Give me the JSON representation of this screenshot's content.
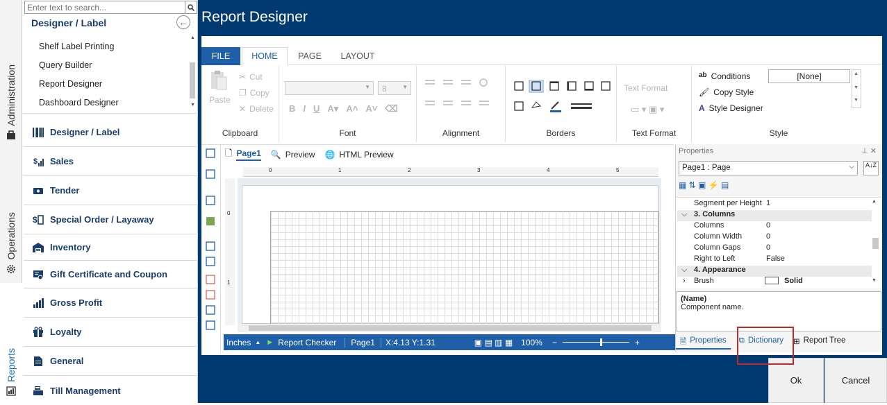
{
  "vertical_tabs": [
    {
      "label": "Administration",
      "icon": "briefcase-icon"
    },
    {
      "label": "Operations",
      "icon": "gear-icon"
    },
    {
      "label": "Reports",
      "icon": "report-icon"
    }
  ],
  "search": {
    "placeholder": "Enter text to search..."
  },
  "nav": {
    "title": "Designer / Label",
    "subitems": [
      "Shelf Label Printing",
      "Query Builder",
      "Report Designer",
      "Dashboard Designer"
    ],
    "categories": [
      {
        "label": "Designer / Label",
        "icon": "barcode-icon"
      },
      {
        "label": "Sales",
        "icon": "sales-icon"
      },
      {
        "label": "Tender",
        "icon": "tender-icon"
      },
      {
        "label": "Special Order / Layaway",
        "icon": "special-order-icon"
      },
      {
        "label": "Inventory",
        "icon": "warehouse-icon"
      },
      {
        "label": "Gift Certificate and Coupon",
        "icon": "certificate-icon"
      },
      {
        "label": "Gross Profit",
        "icon": "bar-chart-icon"
      },
      {
        "label": "Loyalty",
        "icon": "gift-icon"
      },
      {
        "label": "General",
        "icon": "document-icon"
      },
      {
        "label": "Till Management",
        "icon": "cash-register-icon"
      }
    ]
  },
  "window": {
    "title": "Report Designer"
  },
  "ribbon": {
    "tabs": [
      "FILE",
      "HOME",
      "PAGE",
      "LAYOUT"
    ],
    "clipboard": {
      "paste": "Paste",
      "cut": "Cut",
      "copy": "Copy",
      "delete": "Delete",
      "label": "Clipboard"
    },
    "font": {
      "size": "8",
      "label": "Font"
    },
    "alignment": {
      "label": "Alignment"
    },
    "borders": {
      "label": "Borders"
    },
    "text_format": {
      "text": "Text Format",
      "label": "Text Format"
    },
    "style": {
      "conditions": "Conditions",
      "copy_style": "Copy Style",
      "style_designer": "Style Designer",
      "style_value": "[None]",
      "label": "Style"
    }
  },
  "canvas": {
    "tabs": [
      "Page1",
      "Preview",
      "HTML Preview"
    ],
    "ruler_h": [
      "0",
      "1",
      "2",
      "3",
      "4",
      "5"
    ],
    "ruler_v": [
      "0",
      "1"
    ]
  },
  "statusbar": {
    "units": "Inches",
    "checker": "Report Checker",
    "page": "Page1",
    "coords": "X:4.13  Y:1.31",
    "zoom": "100%"
  },
  "properties": {
    "title": "Properties",
    "selected": "Page1 : Page",
    "rows": [
      {
        "name": "Segment per Height",
        "value": "1",
        "type": "prop"
      },
      {
        "name": "3. Columns",
        "value": "",
        "type": "cat"
      },
      {
        "name": "Columns",
        "value": "0",
        "type": "prop"
      },
      {
        "name": "Column Width",
        "value": "0",
        "type": "prop"
      },
      {
        "name": "Column Gaps",
        "value": "0",
        "type": "prop"
      },
      {
        "name": "Right to Left",
        "value": "False",
        "type": "prop"
      },
      {
        "name": "4. Appearance",
        "value": "",
        "type": "cat"
      },
      {
        "name": "Brush",
        "value": "Solid",
        "type": "prop"
      }
    ],
    "desc_title": "(Name)",
    "desc_text": "Component name.",
    "bottom_tabs": [
      "Properties",
      "Dictionary",
      "Report Tree"
    ]
  },
  "buttons": {
    "ok": "Ok",
    "cancel": "Cancel"
  },
  "colors": {
    "navy": "#003a70",
    "accent": "#1e5fa8",
    "highlight": "#c0282c"
  }
}
